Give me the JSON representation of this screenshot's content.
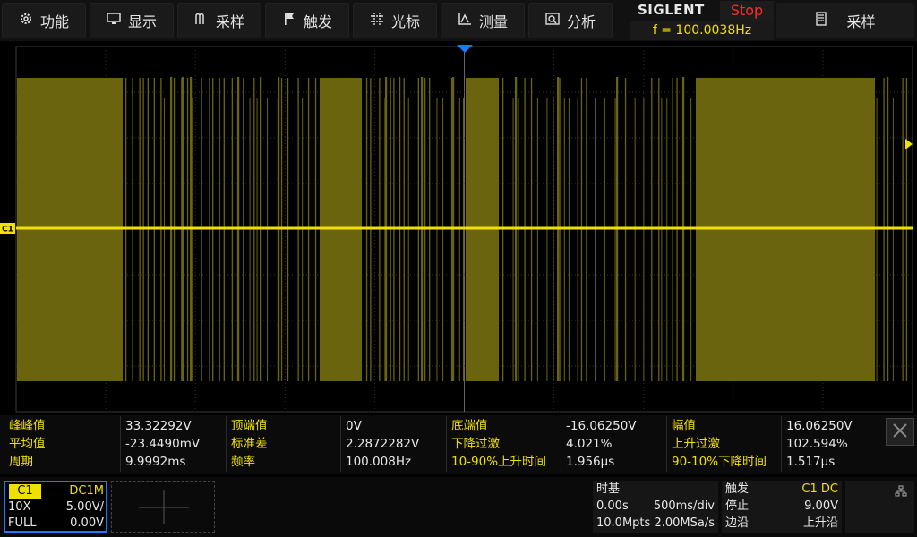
{
  "menu": [
    {
      "label": "功能",
      "icon": "gear-icon"
    },
    {
      "label": "显示",
      "icon": "monitor-icon"
    },
    {
      "label": "采样",
      "icon": "acquire-icon"
    },
    {
      "label": "触发",
      "icon": "flag-icon"
    },
    {
      "label": "光标",
      "icon": "cursor-icon"
    },
    {
      "label": "测量",
      "icon": "measure-icon"
    },
    {
      "label": "分析",
      "icon": "analyze-icon"
    }
  ],
  "brand": {
    "name": "SIGLENT",
    "run_state": "Stop",
    "frequency": "f = 100.0038Hz"
  },
  "right_menu": {
    "label": "采样",
    "icon": "memory-icon"
  },
  "channel_marker": "C1",
  "measurements": [
    [
      {
        "label": "峰峰值",
        "value": "33.32292V"
      },
      {
        "label": "顶端值",
        "value": "0V"
      },
      {
        "label": "底端值",
        "value": "-16.06250V"
      },
      {
        "label": "幅值",
        "value": "16.06250V"
      }
    ],
    [
      {
        "label": "平均值",
        "value": "-23.4490mV"
      },
      {
        "label": "标准差",
        "value": "2.2872282V"
      },
      {
        "label": "下降过激",
        "value": "4.021%"
      },
      {
        "label": "上升过激",
        "value": "102.594%"
      }
    ],
    [
      {
        "label": "周期",
        "value": "9.9992ms"
      },
      {
        "label": "频率",
        "value": "100.008Hz"
      },
      {
        "label": "10-90%上升时间",
        "value": "1.956µs"
      },
      {
        "label": "90-10%下降时间",
        "value": "1.517µs"
      }
    ]
  ],
  "channel1": {
    "name": "C1",
    "coupling": "DC1M",
    "probe": "10X",
    "scale": "5.00V/",
    "bandwidth": "FULL",
    "offset": "0.00V"
  },
  "timebase": {
    "title": "时基",
    "delay": "0.00s",
    "scale": "500ms/div",
    "memory": "10.0Mpts",
    "sample_rate": "2.00MSa/s"
  },
  "trigger": {
    "title": "触发",
    "source": "C1 DC",
    "state": "停止",
    "level": "9.00V",
    "type": "边沿",
    "slope": "上升沿"
  },
  "colors": {
    "trace": "#f0e000",
    "bar_fill": "#6b640e",
    "accent_blue": "#1e78ff",
    "stop_red": "#ff2a2a"
  }
}
